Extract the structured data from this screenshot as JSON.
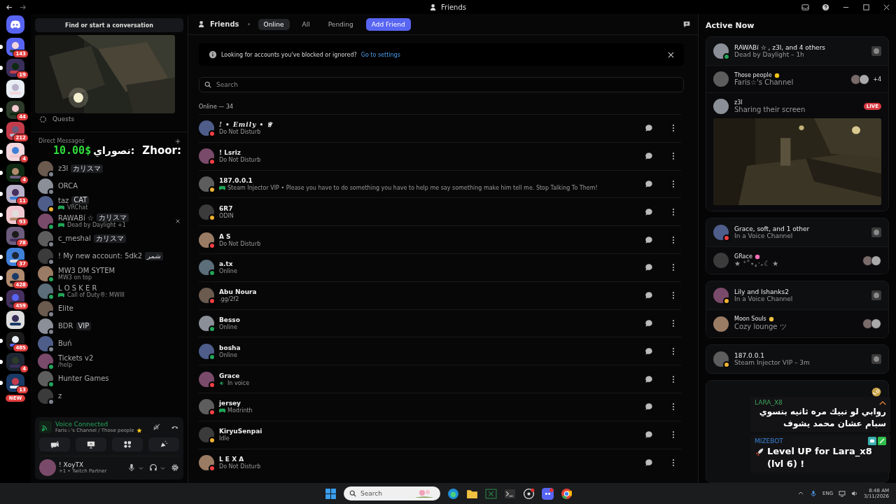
{
  "window": {
    "title": "Friends"
  },
  "servers": [
    {
      "unread": true,
      "badge": "143"
    },
    {
      "unread": true,
      "badge": "19"
    },
    {
      "unread": false
    },
    {
      "unread": true,
      "badge": "44"
    },
    {
      "unread": true,
      "badge": "212"
    },
    {
      "unread": true,
      "badge": "4"
    },
    {
      "unread": true,
      "badge": "4"
    },
    {
      "unread": true,
      "badge": "11"
    },
    {
      "unread": true,
      "badge": "93"
    },
    {
      "unread": false,
      "badge": "78"
    },
    {
      "unread": true,
      "badge": "37"
    },
    {
      "unread": true,
      "badge": "428"
    },
    {
      "unread": true,
      "badge": "459"
    },
    {
      "unread": false
    },
    {
      "unread": true,
      "badge": "485"
    },
    {
      "unread": true,
      "badge": "4"
    },
    {
      "unread": true,
      "badge": "13"
    }
  ],
  "new_badge": "NEW",
  "dm_panel": {
    "search": "Find or start a conversation",
    "quests": "Quests",
    "heading": "Direct Messages"
  },
  "donation": {
    "amount": "10.00$",
    "message": "نصوراي:",
    "donor": "Zhoor:"
  },
  "dms": [
    {
      "name": "z3l",
      "tag": "カリスマ",
      "color": "#80848e",
      "closable": false
    },
    {
      "name": "ORCA",
      "color": "#80848e",
      "closable": false
    },
    {
      "name": "taz",
      "tag": "CAT",
      "activity": "VRChat",
      "game": true,
      "color": "#f0b232",
      "closable": false
    },
    {
      "name": "RAWABí ☆",
      "tag": "カリスマ",
      "activity": "Dead by Daylight +1",
      "game": true,
      "color": "#23a55a",
      "closable": true
    },
    {
      "name": "c_meshal",
      "tag": "カリスマ",
      "color": "#80848e",
      "closable": false
    },
    {
      "name": "! My new account: 5dk2",
      "tag": "شمر",
      "color": "#80848e",
      "closable": false
    },
    {
      "name": "MW3 DM SYTEM",
      "activity": "MW3 on top",
      "game": false,
      "color": "#23a55a",
      "closable": false
    },
    {
      "name": "L O S K E R",
      "activity": "Call of Duty®: MWIII",
      "game": true,
      "color": "#23a55a",
      "closable": false
    },
    {
      "name": "Elite",
      "color": "#80848e",
      "closable": false
    },
    {
      "name": "BDR",
      "tag": "VIP",
      "color": "#80848e",
      "closable": false
    },
    {
      "name": "Buń",
      "color": "#80848e",
      "closable": false
    },
    {
      "name": "Tickets v2",
      "activity": "/help",
      "game": false,
      "color": "#23a55a",
      "closable": false
    },
    {
      "name": "Hunter Games",
      "color": "#23a55a",
      "closable": false
    },
    {
      "name": "z",
      "color": "#80848e",
      "closable": false
    }
  ],
  "voice": {
    "title": "Voice Connected",
    "channel": "Faris☆'s Channel / Those people"
  },
  "user": {
    "name": "! XoyTX",
    "subtitle": "+1 • Twitch Partner"
  },
  "tabs": [
    {
      "label": "Friends",
      "kind": "title",
      "selected": false
    },
    {
      "label": "Online",
      "kind": "tab",
      "selected": true
    },
    {
      "label": "All",
      "kind": "tab",
      "selected": false
    },
    {
      "label": "Pending",
      "kind": "tab",
      "selected": false
    },
    {
      "label": "Add Friend",
      "kind": "action",
      "selected": false
    }
  ],
  "notice": {
    "text": "Looking for accounts you've blocked or ignored?",
    "link": "Go to settings"
  },
  "search": {
    "placeholder": "Search"
  },
  "online_count": "Online — 34",
  "friends": [
    {
      "name": "! • Emily • ♕",
      "status_text": "Do Not Disturb",
      "color": "#f23f43",
      "kind": "plain"
    },
    {
      "name": "! Lsriz",
      "status_text": "Do Not Disturb",
      "color": "#f23f43",
      "kind": "plain"
    },
    {
      "name": "187.0.0.1",
      "status_text": "Steam Injector VIP • Please you have to do something you have to help me say something make him tell me. Stop Talking To Them!",
      "color": "#f0b232",
      "kind": "game"
    },
    {
      "name": "6R7",
      "status_text": "ODIN",
      "color": "#f0b232",
      "kind": "plain"
    },
    {
      "name": "A S",
      "status_text": "Do Not Disturb",
      "color": "#f23f43",
      "kind": "plain"
    },
    {
      "name": "a.tx",
      "status_text": "Online",
      "color": "#23a55a",
      "kind": "plain"
    },
    {
      "name": "Abu Noura",
      "status_text": ".gg/2f2",
      "color": "#f23f43",
      "kind": "plain"
    },
    {
      "name": "Besso",
      "status_text": "Online",
      "color": "#23a55a",
      "kind": "plain"
    },
    {
      "name": "bosha",
      "status_text": "Online",
      "color": "#23a55a",
      "kind": "plain"
    },
    {
      "name": "Grace",
      "status_text": "In voice",
      "color": "#f23f43",
      "kind": "voice"
    },
    {
      "name": "jersey",
      "status_text": "Modrinth",
      "color": "#f23f43",
      "kind": "game"
    },
    {
      "name": "KiryuSenpai",
      "status_text": "Idle",
      "color": "#f0b232",
      "kind": "plain"
    },
    {
      "name": "L E X A",
      "status_text": "Do Not Disturb",
      "color": "#f23f43",
      "kind": "plain"
    }
  ],
  "active_now": {
    "title": "Active Now",
    "cards": [
      {
        "title": "RAWABí ☆ , z3l, and 4 others",
        "subtitle": "Dead by Daylight – 1h",
        "color": "#23a55a",
        "rows": [
          {
            "kind": "voice",
            "title": "Those people",
            "subtitle": "Faris☆'s Channel",
            "more": "+4"
          },
          {
            "kind": "stream",
            "title": "z3l",
            "subtitle": "Sharing their screen",
            "badge": "LIVE"
          }
        ]
      },
      {
        "title": "Grace, soft, and 1 other",
        "subtitle": "In a Voice Channel",
        "color": "#f23f43",
        "rows": [
          {
            "kind": "voice",
            "title": "GRace",
            "subtitle": "★ ⁺˚⋆｡‧₊☾ ★"
          }
        ]
      },
      {
        "title": "Lily and Ishanks2",
        "subtitle": "In a Voice Channel",
        "color": "#f0b232",
        "rows": [
          {
            "kind": "voice",
            "title": "Moon Souls",
            "subtitle": "Cozy lounge ツ"
          }
        ]
      },
      {
        "title": "187.0.0.1",
        "subtitle": "Steam Injector VIP – 3m",
        "color": "#f0b232"
      }
    ]
  },
  "chat_overlay": [
    {
      "user": "LARA_X8",
      "color": "#3fa45b",
      "text": "روابي لو نبيك مره ثانيه بنسوي سبام عشان محمد يشوف"
    },
    {
      "user": "MIZEBOT",
      "color": "#3b82d6",
      "text": "Level UP for Lara_x8 (lvl 6) !"
    }
  ],
  "taskbar": {
    "search": {
      "placeholder": "Search"
    },
    "language": "ENG",
    "time": "8:48 AM",
    "date": "3/11/2026"
  }
}
